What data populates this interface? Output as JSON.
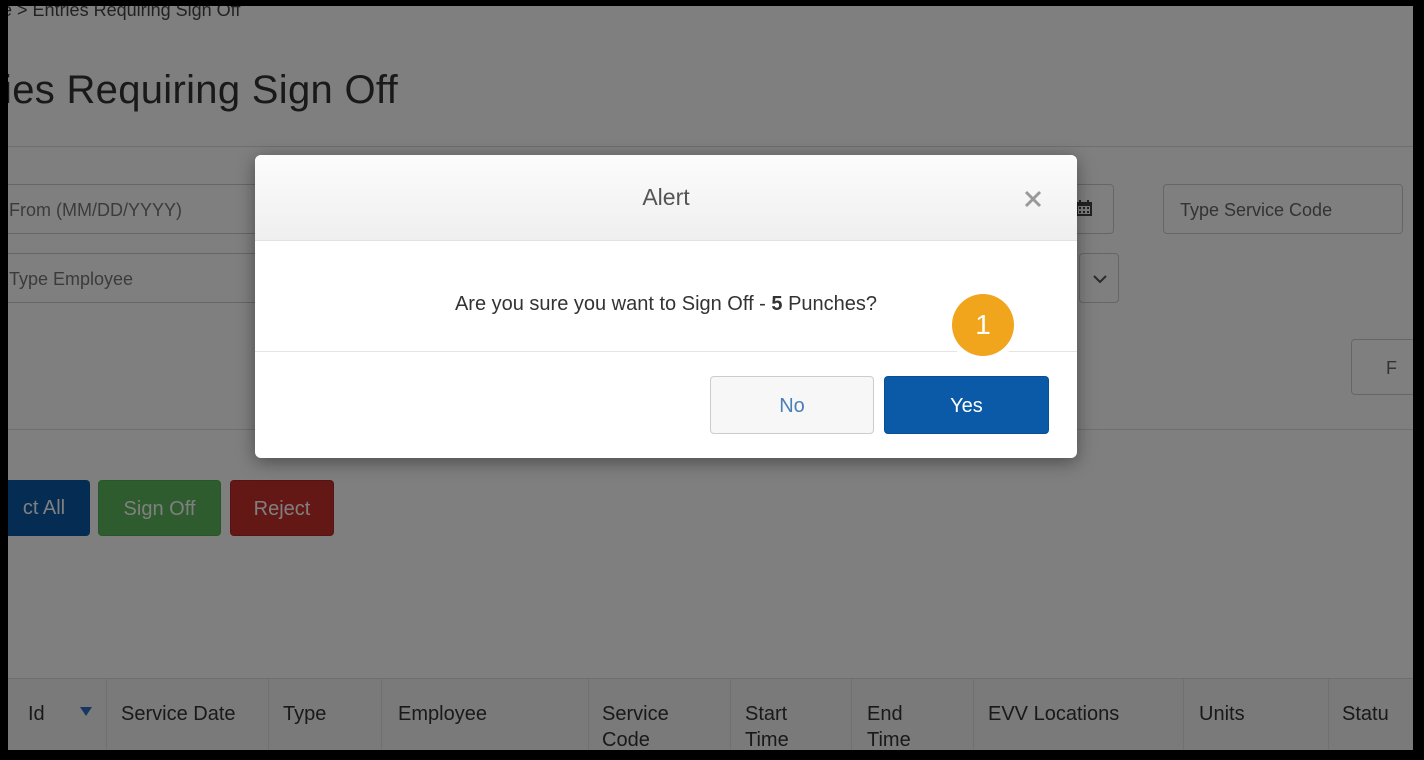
{
  "breadcrumb": {
    "home": "e",
    "current": "Entries Requiring Sign Off"
  },
  "page_title": "tries Requiring Sign Off",
  "filters": {
    "date_from_placeholder": "From (MM/DD/YYYY)",
    "service_code_placeholder": "Type Service Code",
    "employee_placeholder": "Type Employee",
    "search_label": "F"
  },
  "actions": {
    "select_all": "ct All",
    "sign_off": "Sign Off",
    "reject": "Reject"
  },
  "table": {
    "columns": [
      "Id",
      "Service Date",
      "Type",
      "Employee",
      "Service Code",
      "Start Time",
      "End Time",
      "EVV Locations",
      "Units",
      "Statu"
    ]
  },
  "modal": {
    "title": "Alert",
    "message_prefix": "Are you sure you want to Sign Off - ",
    "count": "5",
    "message_suffix": " Punches?",
    "no_label": "No",
    "yes_label": "Yes"
  },
  "annotation": {
    "badge_number": "1"
  },
  "colors": {
    "primary_blue": "#0b5aa8",
    "sign_off_green": "#5cb85c",
    "reject_red": "#c9302c",
    "badge_orange": "#f0a51c"
  },
  "icons": [
    "calendar-icon",
    "chevron-down-icon",
    "close-icon",
    "sort-desc-icon"
  ]
}
